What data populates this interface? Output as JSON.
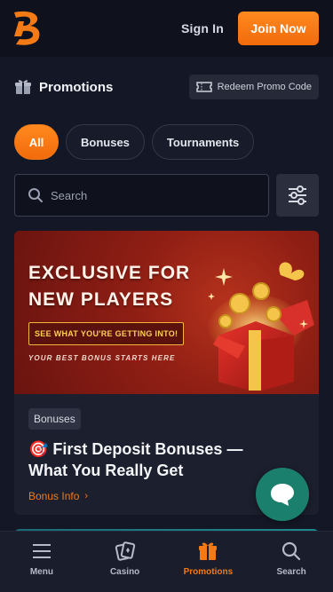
{
  "header": {
    "logo_letter": "B",
    "sign_in_label": "Sign In",
    "join_label": "Join Now",
    "accent_color": "#f47a15"
  },
  "section": {
    "title": "Promotions",
    "icon": "gift-icon",
    "redeem_label": "Redeem Promo Code"
  },
  "tabs": [
    {
      "label": "All",
      "active": true
    },
    {
      "label": "Bonuses",
      "active": false
    },
    {
      "label": "Tournaments",
      "active": false
    }
  ],
  "search": {
    "placeholder": "Search",
    "value": ""
  },
  "promo_card": {
    "banner": {
      "line1": "EXCLUSIVE FOR",
      "line2": "NEW PLAYERS",
      "cta": "SEE WHAT YOU'RE GETTING INTO!",
      "tagline": "YOUR BEST BONUS STARTS HERE"
    },
    "badge": "Bonuses",
    "title": "🎯 First Deposit Bonuses — What You Really Get",
    "link_label": "Bonus Info"
  },
  "bottom_nav": [
    {
      "label": "Menu",
      "icon": "menu-icon",
      "active": false
    },
    {
      "label": "Casino",
      "icon": "cards-icon",
      "active": false
    },
    {
      "label": "Promotions",
      "icon": "gift-icon",
      "active": true
    },
    {
      "label": "Search",
      "icon": "search-icon",
      "active": false
    }
  ]
}
